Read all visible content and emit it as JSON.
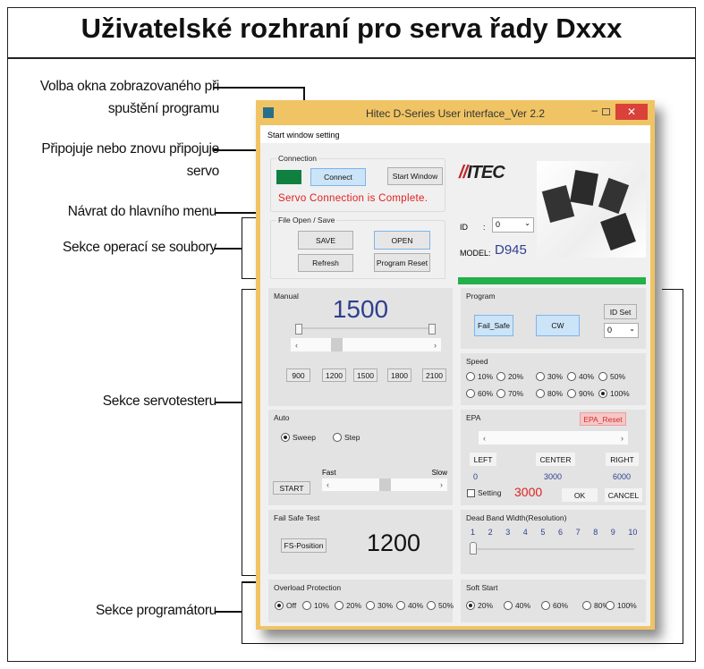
{
  "heading": "Uživatelské rozhraní pro serva řady Dxxx",
  "annotations": {
    "start_window": "Volba okna zobrazovaného při spuštění programu",
    "connect": "Připojuje nebo znovu připojuje servo",
    "main_menu": "Návrat do hlavního menu",
    "files": "Sekce operací se soubory",
    "servotester": "Sekce servotesteru",
    "programmer": "Sekce programátoru"
  },
  "window": {
    "title": "Hitec D-Series User interface_Ver 2.2",
    "menu": "Start window setting",
    "connection": {
      "label": "Connection",
      "connect": "Connect",
      "start_window": "Start Window",
      "status": "Servo Connection is Complete.",
      "indicator_color": "#108040"
    },
    "file": {
      "label": "File Open / Save",
      "save": "SAVE",
      "open": "OPEN",
      "refresh": "Refresh",
      "reset": "Program Reset"
    },
    "logo": "HITEC",
    "id": {
      "label": "ID",
      "colon": ":",
      "value": "0"
    },
    "model": {
      "label": "MODEL:",
      "value": "D945"
    },
    "progress": 100,
    "manual": {
      "label": "Manual",
      "value": "1500",
      "presets": [
        "900",
        "1200",
        "1500",
        "1800",
        "2100"
      ]
    },
    "program": {
      "label": "Program",
      "fail_safe": "Fail_Safe",
      "cw": "CW",
      "id_set": "ID Set",
      "id_value": "0"
    },
    "speed": {
      "label": "Speed",
      "options": [
        "10%",
        "20%",
        "30%",
        "40%",
        "50%",
        "60%",
        "70%",
        "80%",
        "90%",
        "100%"
      ],
      "selected": "100%"
    },
    "auto": {
      "label": "Auto",
      "sweep": "Sweep",
      "step": "Step",
      "selected": "Sweep",
      "start": "START",
      "fast": "Fast",
      "slow": "Slow"
    },
    "epa": {
      "label": "EPA",
      "reset": "EPA_Reset",
      "left": "LEFT",
      "center": "CENTER",
      "right": "RIGHT",
      "left_val": "0",
      "center_val": "3000",
      "right_val": "6000",
      "setting": "Setting",
      "current": "3000",
      "ok": "OK",
      "cancel": "CANCEL"
    },
    "failsafe": {
      "label": "Fail Safe Test",
      "button": "FS-Position",
      "value": "1200"
    },
    "deadband": {
      "label": "Dead Band Width(Resolution)",
      "ticks": [
        "1",
        "2",
        "3",
        "4",
        "5",
        "6",
        "7",
        "8",
        "9",
        "10"
      ],
      "value": 1
    },
    "overload": {
      "label": "Overload Protection",
      "options": [
        "Off",
        "10%",
        "20%",
        "30%",
        "40%",
        "50%"
      ],
      "selected": "Off"
    },
    "softstart": {
      "label": "Soft Start",
      "options": [
        "20%",
        "40%",
        "60%",
        "80%",
        "100%"
      ],
      "selected": "20%"
    }
  }
}
